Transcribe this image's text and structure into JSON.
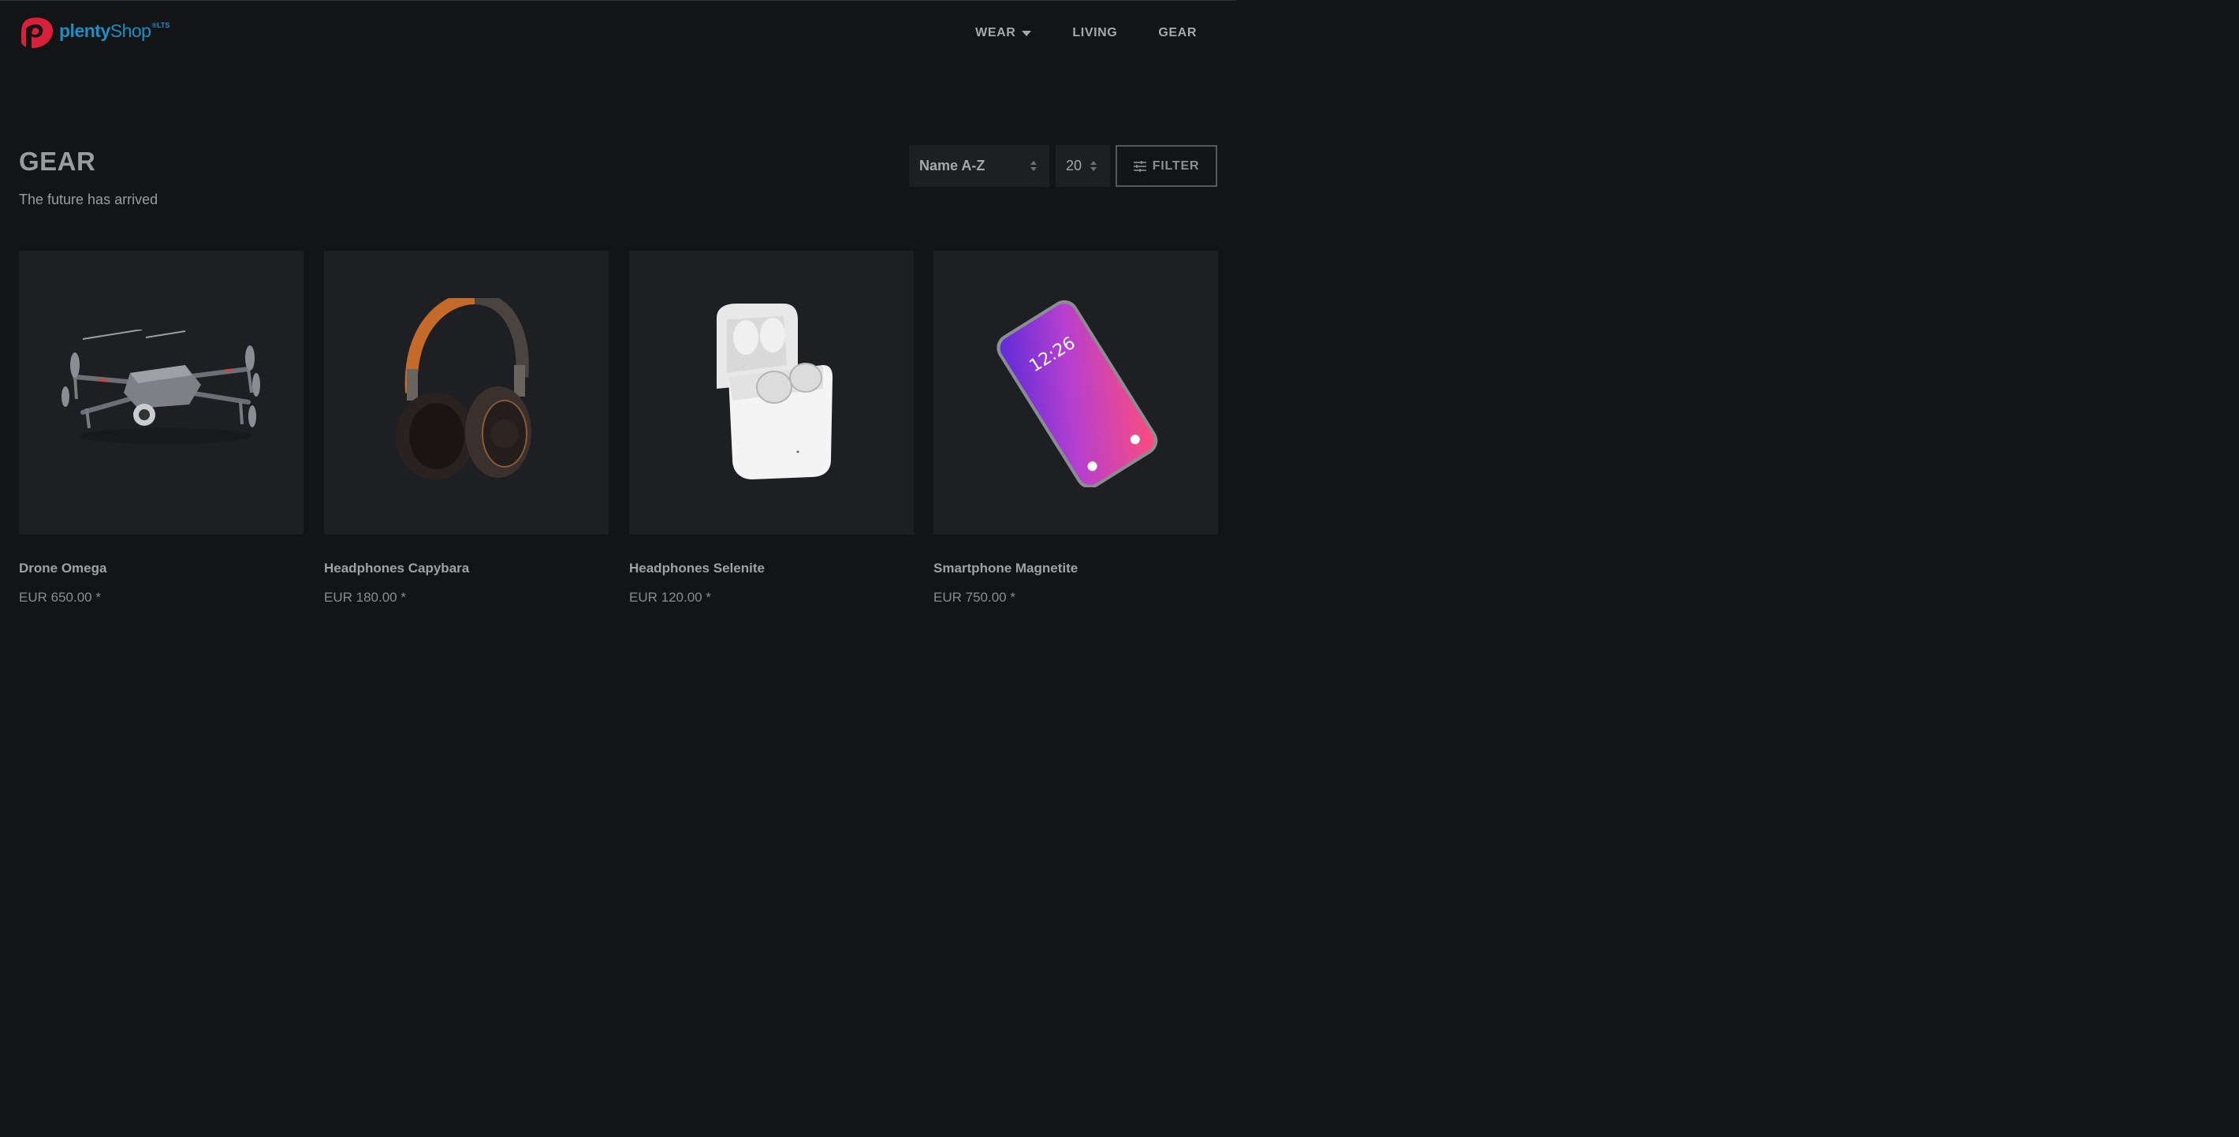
{
  "brand": {
    "name_part1": "plenty",
    "name_part2": "Shop",
    "suffix": "®LTS"
  },
  "nav": {
    "items": [
      {
        "label": "WEAR",
        "has_dropdown": true
      },
      {
        "label": "LIVING",
        "has_dropdown": false
      },
      {
        "label": "GEAR",
        "has_dropdown": false
      }
    ]
  },
  "category": {
    "title": "GEAR",
    "description": "The future has arrived"
  },
  "controls": {
    "sort_value": "Name A-Z",
    "items_per_page": "20",
    "filter_label": "FILTER"
  },
  "products": [
    {
      "name": "Drone Omega",
      "price": "EUR 650.00 *",
      "image_icon": "drone-image"
    },
    {
      "name": "Headphones Capybara",
      "price": "EUR 180.00 *",
      "image_icon": "headphones-image"
    },
    {
      "name": "Headphones Selenite",
      "price": "EUR 120.00 *",
      "image_icon": "earbuds-case-image"
    },
    {
      "name": "Smartphone Magnetite",
      "price": "EUR 750.00 *",
      "image_icon": "smartphone-image",
      "screen_time": "12:26"
    }
  ],
  "colors": {
    "background": "#121416",
    "card": "#1d1f22",
    "brand_red": "#d8203a",
    "brand_blue": "#1b8fc4"
  }
}
